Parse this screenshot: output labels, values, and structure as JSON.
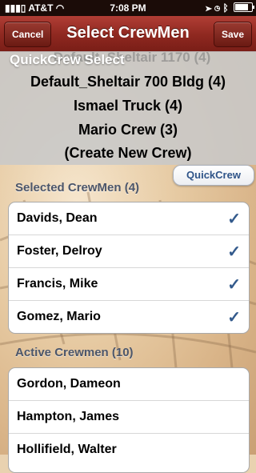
{
  "status_bar": {
    "carrier": "AT&T",
    "time": "7:08 PM",
    "battery_level": 0.8
  },
  "nav": {
    "cancel_label": "Cancel",
    "title": "Select CrewMen",
    "save_label": "Save"
  },
  "quickcrew_picker": {
    "header": "QuickCrew Select",
    "ghost_option": "Default_Sheltair 1170 (4)",
    "options": [
      "Default_Sheltair 700 Bldg (4)",
      "Ismael Truck (4)",
      "Mario Crew (3)",
      "(Create New Crew)"
    ]
  },
  "quickcrew_button_label": "QuickCrew",
  "selected": {
    "title": "Selected CrewMen (4)",
    "rows": [
      {
        "name": "Davids, Dean",
        "check": "✓"
      },
      {
        "name": "Foster, Delroy",
        "check": "✓"
      },
      {
        "name": "Francis, Mike",
        "check": "✓"
      },
      {
        "name": "Gomez, Mario",
        "check": "✓"
      }
    ]
  },
  "active": {
    "title": "Active Crewmen (10)",
    "rows": [
      {
        "name": "Gordon, Dameon"
      },
      {
        "name": "Hampton, James"
      },
      {
        "name": "Hollifield, Walter"
      }
    ]
  },
  "colors": {
    "nav_bar": "#8e2820",
    "check": "#335a8c",
    "section_title": "#4c566a"
  }
}
